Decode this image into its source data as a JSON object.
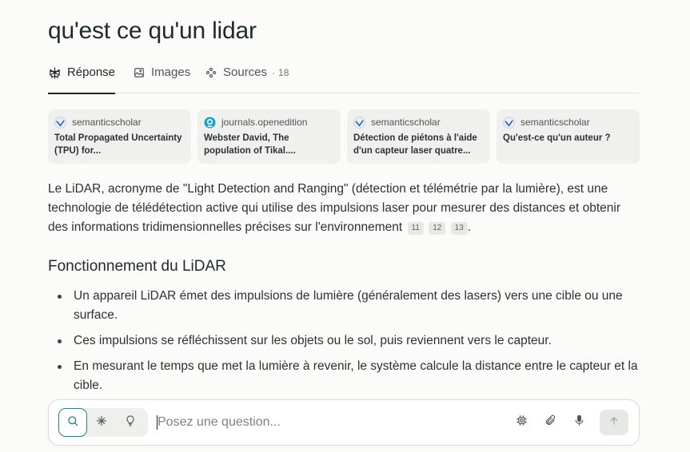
{
  "query": "qu'est ce qu'un lidar",
  "tabs": [
    {
      "label": "Réponse",
      "icon": "perplexity-logo-icon"
    },
    {
      "label": "Images",
      "icon": "image-icon"
    },
    {
      "label": "Sources",
      "icon": "sources-icon",
      "count": "18",
      "separator": "·"
    }
  ],
  "sources": [
    {
      "site": "semanticscholar",
      "title": "Total Propagated Uncertainty (TPU) for...",
      "icon": "semanticscholar-icon"
    },
    {
      "site": "journals.openedition",
      "title": "Webster David, The population of Tikal....",
      "icon": "openedition-icon"
    },
    {
      "site": "semanticscholar",
      "title": "Détection de piétons à l'aide d'un capteur laser quatre...",
      "icon": "semanticscholar-icon"
    },
    {
      "site": "semanticscholar",
      "title": "Qu'est-ce qu'un auteur ?",
      "icon": "semanticscholar-icon"
    }
  ],
  "answer": {
    "intro": "Le LiDAR, acronyme de \"Light Detection and Ranging\" (détection et télémétrie par la lumière), est une technologie de télédétection active qui utilise des impulsions laser pour mesurer des distances et obtenir des informations tridimensionnelles précises sur l'environnement",
    "citations": [
      "11",
      "12",
      "13"
    ],
    "end_punct": ".",
    "section_heading": "Fonctionnement du LiDAR",
    "bullets": [
      "Un appareil LiDAR émet des impulsions de lumière (généralement des lasers) vers une cible ou une surface.",
      "Ces impulsions se réfléchissent sur les objets ou le sol, puis reviennent vers le capteur.",
      "En mesurant le temps que met la lumière à revenir, le système calcule la distance entre le capteur et la cible."
    ]
  },
  "composer": {
    "placeholder": "Posez une question...",
    "modes": [
      "search-icon",
      "reasoning-icon",
      "lightbulb-icon"
    ],
    "tools": [
      "chip-icon",
      "paperclip-icon",
      "microphone-icon"
    ],
    "send_icon": "arrow-up-icon"
  },
  "colors": {
    "accent": "#2f7c86",
    "background": "#fbfbf9",
    "card": "#f0f1ee"
  }
}
